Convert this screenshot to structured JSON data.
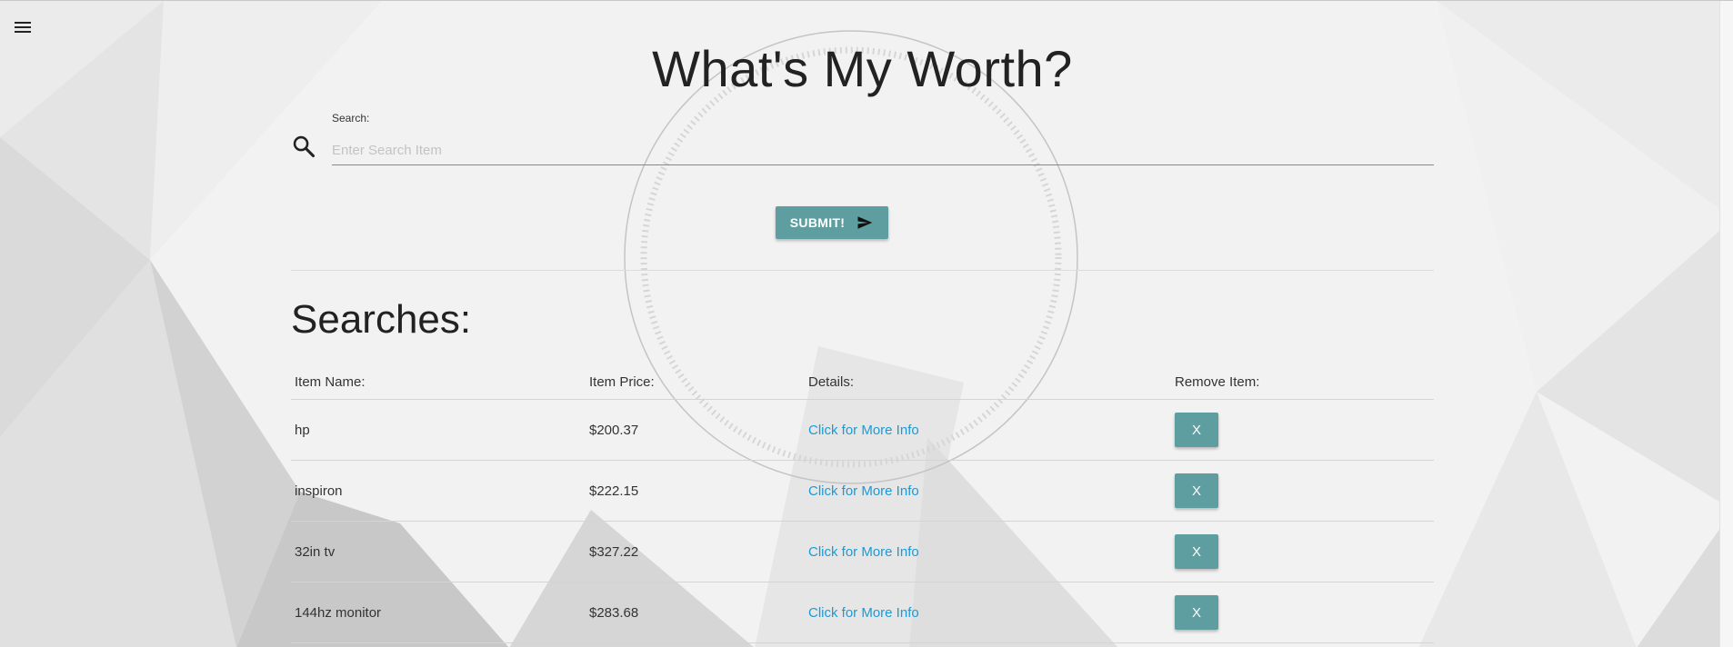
{
  "header": {
    "menu_icon": "hamburger-menu-icon",
    "title": "What's My Worth?"
  },
  "search": {
    "label": "Search:",
    "placeholder": "Enter Search Item",
    "value": "",
    "icon": "search-icon"
  },
  "submit": {
    "label": "SUBMIT!",
    "icon": "send-icon",
    "color": "#5f9ea0"
  },
  "searches": {
    "title": "Searches:",
    "columns": [
      "Item Name:",
      "Item Price:",
      "Details:",
      "Remove Item:"
    ],
    "rows": [
      {
        "name": "hp",
        "price": "$200.37",
        "details": "Click for More Info",
        "remove": "X"
      },
      {
        "name": "inspiron",
        "price": "$222.15",
        "details": "Click for More Info",
        "remove": "X"
      },
      {
        "name": "32in tv",
        "price": "$327.22",
        "details": "Click for More Info",
        "remove": "X"
      },
      {
        "name": "144hz monitor",
        "price": "$283.68",
        "details": "Click for More Info",
        "remove": "X"
      }
    ]
  },
  "colors": {
    "accent": "#5f9ea0",
    "link": "#1a9bd7"
  }
}
